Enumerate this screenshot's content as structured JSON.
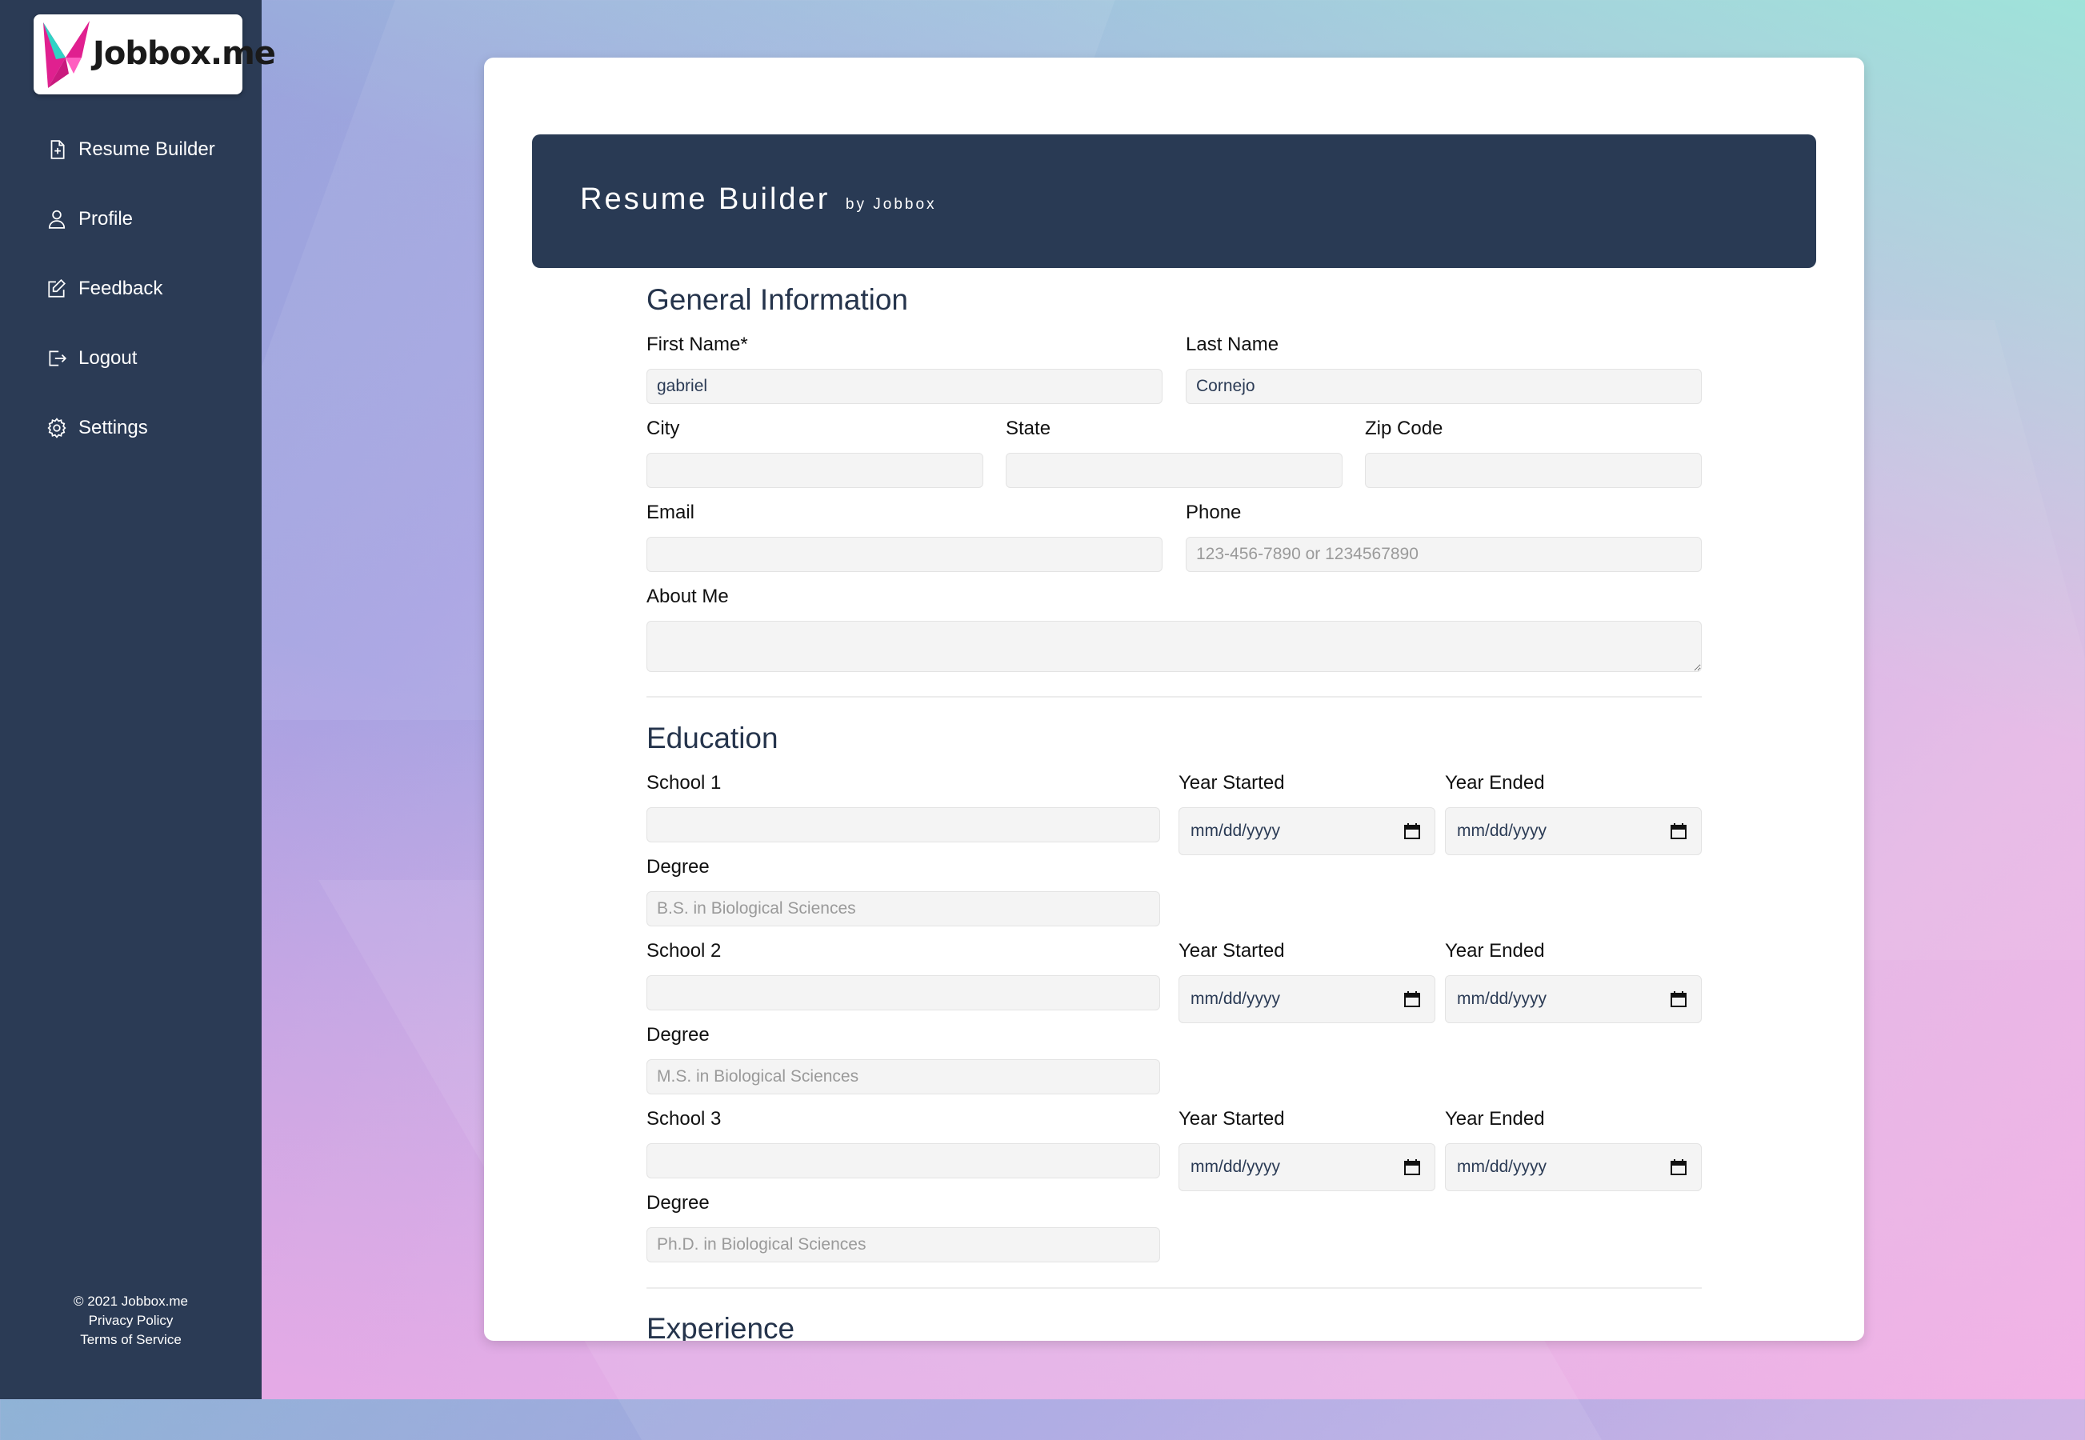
{
  "app": {
    "logo_text": "Jobbox.me"
  },
  "sidebar": {
    "items": [
      {
        "label": "Resume Builder",
        "icon": "file-plus-icon"
      },
      {
        "label": "Profile",
        "icon": "person-icon"
      },
      {
        "label": "Feedback",
        "icon": "edit-icon"
      },
      {
        "label": "Logout",
        "icon": "logout-icon"
      },
      {
        "label": "Settings",
        "icon": "gear-icon"
      }
    ],
    "footer": {
      "copyright": "© 2021 Jobbox.me",
      "privacy": "Privacy Policy",
      "terms": "Terms of Service"
    }
  },
  "banner": {
    "title": "Resume Builder",
    "subtitle": "by Jobbox"
  },
  "general": {
    "title": "General Information",
    "first_name": {
      "label": "First Name*",
      "value": "gabriel"
    },
    "last_name": {
      "label": "Last Name",
      "value": "Cornejo"
    },
    "city": {
      "label": "City",
      "value": ""
    },
    "state": {
      "label": "State",
      "value": ""
    },
    "zip": {
      "label": "Zip Code",
      "value": ""
    },
    "email": {
      "label": "Email",
      "value": ""
    },
    "phone": {
      "label": "Phone",
      "placeholder": "123-456-7890 or 1234567890"
    },
    "about": {
      "label": "About Me",
      "value": ""
    }
  },
  "education": {
    "title": "Education",
    "year_started_label": "Year Started",
    "year_ended_label": "Year Ended",
    "degree_label": "Degree",
    "date_placeholder": "mm/dd/yyyy",
    "schools": [
      {
        "label": "School 1",
        "degree_placeholder": "B.S. in Biological Sciences"
      },
      {
        "label": "School 2",
        "degree_placeholder": "M.S. in Biological Sciences"
      },
      {
        "label": "School 3",
        "degree_placeholder": "Ph.D. in Biological Sciences"
      }
    ]
  },
  "experience": {
    "title": "Experience"
  },
  "colors": {
    "sidebar": "#2b3b55",
    "banner": "#293a54",
    "input_bg": "#f4f4f4"
  }
}
